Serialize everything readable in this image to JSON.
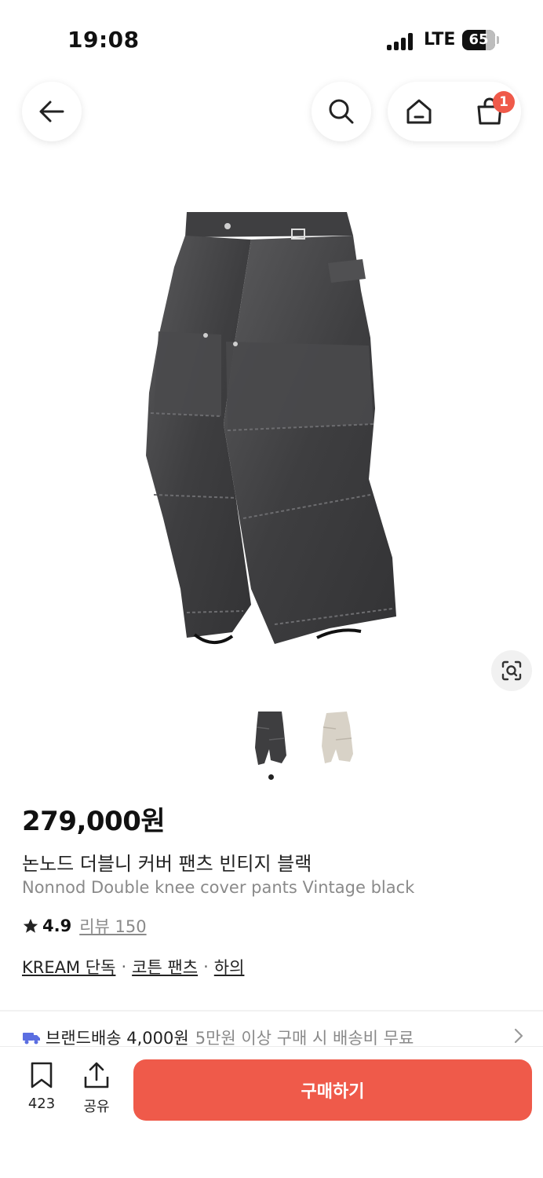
{
  "status_bar": {
    "time": "19:08",
    "network": "LTE",
    "battery": "65"
  },
  "nav": {
    "back_icon": "arrow-left-icon",
    "search_icon": "search-icon",
    "home_icon": "home-icon",
    "cart_icon": "shopping-bag-icon",
    "cart_count": "1"
  },
  "gallery": {
    "current_index": 1,
    "total": 2,
    "lens_icon": "visual-search-icon"
  },
  "product": {
    "price": "279,000원",
    "name_ko": "논노드 더블니 커버 팬츠 빈티지 블랙",
    "name_en": "Nonnod Double knee cover pants Vintage black",
    "rating": "4.9",
    "review_label": "리뷰 150",
    "categories": [
      "KREAM 단독",
      "코튼 팬츠",
      "하의"
    ]
  },
  "shipping": {
    "label": "브랜드배송 4,000원",
    "sub": "5만원 이상 구매 시 배송비 무료"
  },
  "bottom_bar": {
    "bookmark_count": "423",
    "share_label": "공유",
    "buy_label": "구매하기"
  },
  "colors": {
    "accent": "#ef5a4a",
    "truck": "#5b6ee1"
  }
}
